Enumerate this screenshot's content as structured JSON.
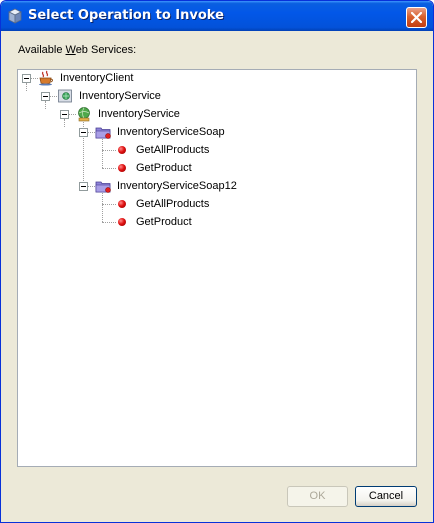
{
  "window": {
    "title": "Select Operation to Invoke"
  },
  "content": {
    "label_prefix": "Available ",
    "label_mnemonic": "W",
    "label_suffix": "eb Services:"
  },
  "tree": {
    "client": "InventoryClient",
    "service": "InventoryService",
    "port_group": "InventoryService",
    "port_soap": "InventoryServiceSoap",
    "soap_op1": "GetAllProducts",
    "soap_op2": "GetProduct",
    "port_soap12": "InventoryServiceSoap12",
    "soap12_op1": "GetAllProducts",
    "soap12_op2": "GetProduct"
  },
  "buttons": {
    "ok": "OK",
    "cancel": "Cancel"
  },
  "colors": {
    "titlebar": "#0257e8",
    "dialog_bg": "#ece9d8",
    "close_button": "#d9622e",
    "operation_dot": "#e01010"
  },
  "icons": {
    "title": "cube-icon",
    "close": "close-icon",
    "client": "coffee-cup-icon",
    "service": "web-service-icon",
    "port_group": "globe-person-icon",
    "port": "folder-port-icon",
    "operation": "red-dot-icon"
  }
}
